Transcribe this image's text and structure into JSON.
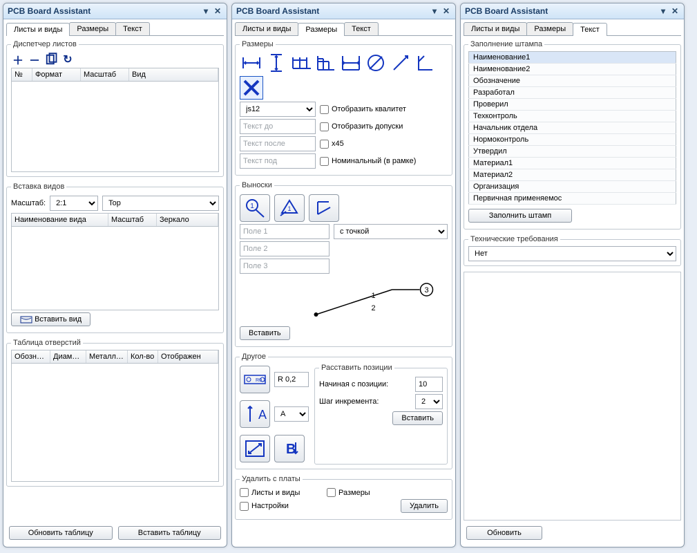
{
  "app_title": "PCB Board Assistant",
  "tabs": {
    "sheets": "Листы и виды",
    "dims": "Размеры",
    "text": "Текст"
  },
  "panel1": {
    "sheet_mgr": "Диспетчер листов",
    "grid_hdr": {
      "n": "№",
      "fmt": "Формат",
      "scale": "Масштаб",
      "view": "Вид"
    },
    "insert_views": "Вставка видов",
    "scale_lbl": "Масштаб:",
    "scale_val": "2:1",
    "orient": "Top",
    "views_hdr": {
      "name": "Наименование вида",
      "scale": "Масштаб",
      "mirror": "Зеркало"
    },
    "insert_view_btn": "Вставить вид",
    "holes_tbl": "Таблица отверстий",
    "holes_hdr": {
      "desig": "Обозначен",
      "dia": "Диаметр отв.",
      "met": "Металлиза",
      "qty": "Кол-во",
      "disp": "Отображен"
    },
    "refresh_btn": "Обновить таблицу",
    "insert_btn": "Вставить таблицу"
  },
  "panel2": {
    "dims_grp": "Размеры",
    "qualitet": "js12",
    "txt_before": "Текст до",
    "txt_after": "Текст после",
    "txt_under": "Текст под",
    "cb": {
      "show_q": "Отобразить квалитет",
      "show_tol": "Отобразить допуски",
      "x45": "x45",
      "nom": "Номинальный (в рамке)"
    },
    "leaders_grp": "Выноски",
    "field1": "Поле 1",
    "field2": "Поле 2",
    "field3": "Поле 3",
    "leader_style": "с точкой",
    "preview": {
      "a": "1",
      "b": "2",
      "c": "3"
    },
    "insert_btn": "Вставить",
    "other_grp": "Другое",
    "r02": "R 0,2",
    "a_sel": "A",
    "place_grp": "Расставить позиции",
    "start_lbl": "Начиная с позиции:",
    "start_val": "10",
    "step_lbl": "Шаг инкремента:",
    "step_val": "2",
    "place_btn": "Вставить",
    "delete_grp": "Удалить с платы",
    "del_cb": {
      "sheets": "Листы и виды",
      "dims": "Размеры",
      "settings": "Настройки"
    },
    "delete_btn": "Удалить"
  },
  "panel3": {
    "stamp_grp": "Заполнение штампа",
    "rows": [
      "Наименование1",
      "Наименование2",
      "Обозначение",
      "Разработал",
      "Проверил",
      "Техконтроль",
      "Начальник отдела",
      "Нормоконтроль",
      "Утвердил",
      "Материал1",
      "Материал2",
      "Организация",
      "Первичная применяемос"
    ],
    "fill_btn": "Заполнить штамп",
    "tech_grp": "Технические требования",
    "tech_val": "Нет",
    "upd_btn": "Обновить"
  }
}
